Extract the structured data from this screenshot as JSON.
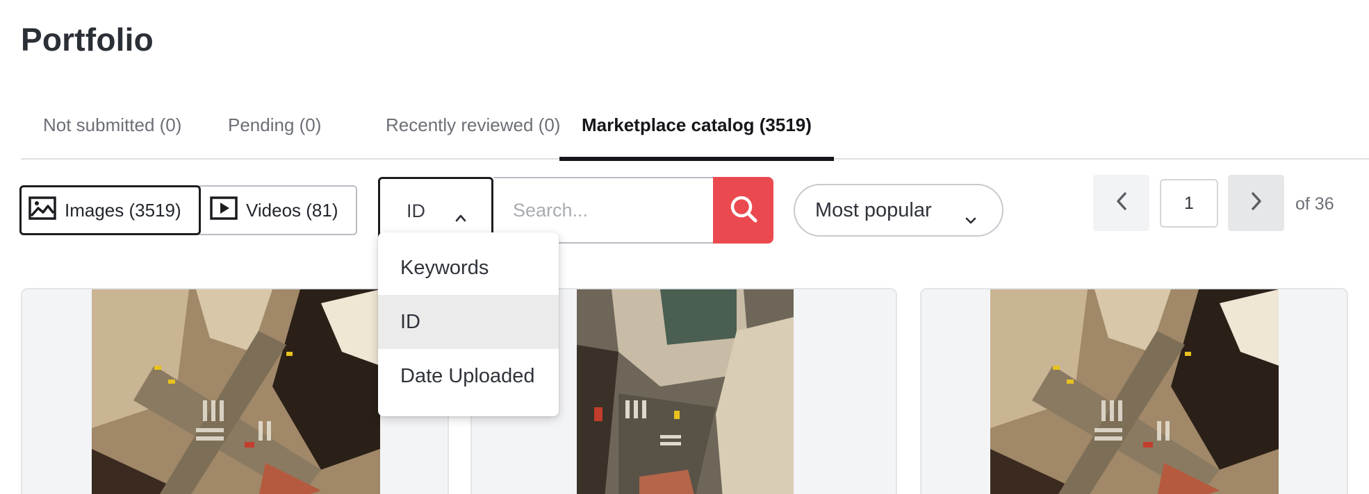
{
  "page": {
    "title": "Portfolio"
  },
  "tabs": [
    {
      "label": "Not submitted (0)",
      "active": false
    },
    {
      "label": "Pending (0)",
      "active": false
    },
    {
      "label": "Recently reviewed (0)",
      "active": false
    },
    {
      "label": "Marketplace catalog (3519)",
      "active": true
    }
  ],
  "media_filter": {
    "images_label": "Images (3519)",
    "videos_label": "Videos (81)",
    "selected": "images"
  },
  "search": {
    "field_selected": "ID",
    "placeholder": "Search...",
    "value": "",
    "field_options": [
      {
        "label": "Keywords",
        "selected": false
      },
      {
        "label": "ID",
        "selected": true
      },
      {
        "label": "Date Uploaded",
        "selected": false
      }
    ]
  },
  "sort": {
    "label": "Most popular"
  },
  "pagination": {
    "current": "1",
    "total_label": "of 36"
  },
  "colors": {
    "accent": "#ea4a4f",
    "text_dark": "#14161a",
    "muted": "#6b6f76"
  },
  "icons": {
    "images": "image-icon",
    "videos": "video-icon",
    "search": "search-icon",
    "field_chevron": "chevron-up-icon",
    "sort_chevron": "chevron-down-icon",
    "prev": "chevron-left-icon",
    "next": "chevron-right-icon"
  }
}
